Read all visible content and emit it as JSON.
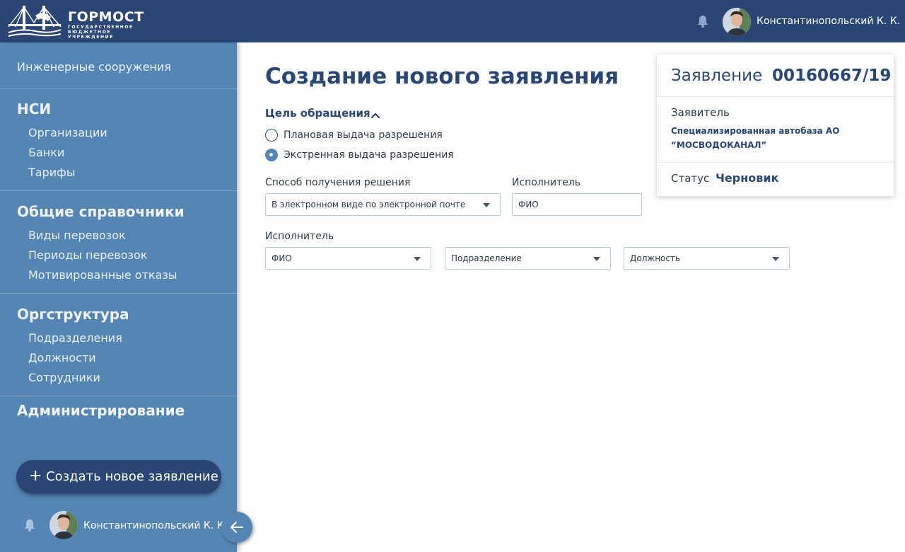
{
  "header": {
    "logo_title": "ГОРМОСТ",
    "logo_subtitle": "ГОСУДАРСТВЕННОЕ БЮДЖЕТНОЕ УЧРЕЖДЕНИЕ",
    "user_name": "Константинопольский К. К."
  },
  "sidebar": {
    "top_link": "Инженерные сооружения",
    "sections": [
      {
        "title": "НСИ",
        "items": [
          "Организации",
          "Банки",
          "Тарифы"
        ]
      },
      {
        "title": "Общие справочники",
        "items": [
          "Виды перевозок",
          "Периоды перевозок",
          "Мотивированные отказы"
        ]
      },
      {
        "title": "Оргструктура",
        "items": [
          "Подразделения",
          "Должности",
          "Сотрудники"
        ]
      },
      {
        "title": "Администрирование",
        "items": []
      }
    ],
    "create_button": "Создать новое заявление",
    "user_name": "Константинопольский К. К."
  },
  "main": {
    "title": "Создание нового заявления",
    "purpose": {
      "label": "Цель обращения",
      "options": [
        {
          "label": "Плановая выдача разрешения",
          "checked": false
        },
        {
          "label": "Экстренная выдача разрешения",
          "checked": true
        }
      ]
    },
    "receive_method": {
      "label": "Способ получения решения",
      "value": "В электронном виде по электронной почте"
    },
    "executor_top": {
      "label": "Исполнитель",
      "placeholder": "ФИО"
    },
    "executor": {
      "label": "Исполнитель",
      "fio": "ФИО",
      "department": "Подразделение",
      "position": "Должность"
    }
  },
  "card": {
    "title": "Заявление",
    "number": "00160667/19",
    "applicant_label": "Заявитель",
    "applicant": "Специализированная автобаза АО “МОСВОДОКАНАЛ”",
    "status_label": "Статус",
    "status": "Черновик"
  },
  "colors": {
    "primary": "#2a4674",
    "sidebar": "#5585b5",
    "border": "#b7c9da"
  },
  "icons": {
    "notifications": "bell-icon",
    "collapse": "arrow-left-icon",
    "expand": "chevron-up-icon",
    "create": "plus-icon"
  }
}
